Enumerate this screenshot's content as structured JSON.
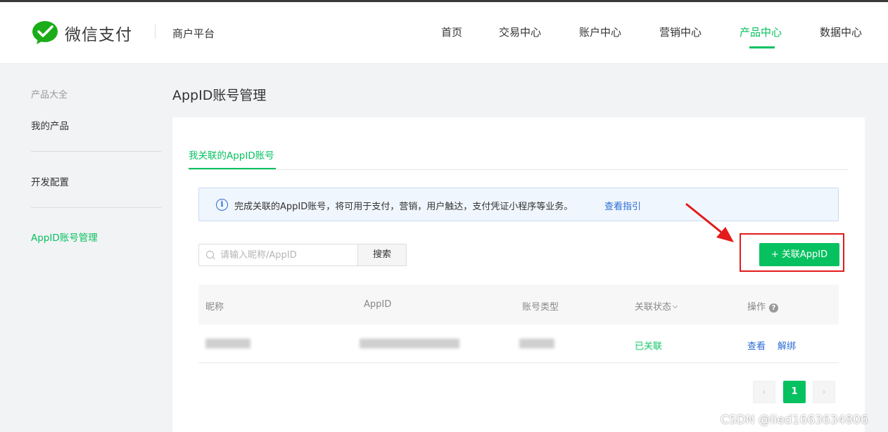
{
  "header": {
    "brand_name": "微信支付",
    "subtitle": "商户平台",
    "nav": [
      "首页",
      "交易中心",
      "账户中心",
      "营销中心",
      "产品中心",
      "数据中心"
    ],
    "active_nav": "产品中心"
  },
  "sidebar": {
    "group_label": "产品大全",
    "items": [
      "我的产品",
      "开发配置",
      "AppID账号管理"
    ],
    "active_item": "AppID账号管理"
  },
  "main": {
    "title": "AppID账号管理",
    "tab": "我关联的AppID账号",
    "notice_text": "完成关联的AppID账号，将可用于支付，营销，用户触达，支付凭证小程序等业务。",
    "notice_link": "查看指引",
    "search_placeholder": "请输入昵称/AppID",
    "search_button": "搜索",
    "add_button": "+ 关联AppID",
    "table": {
      "headers": [
        "昵称",
        "AppID",
        "账号类型",
        "关联状态",
        "操作"
      ],
      "rows": [
        {
          "status": "已关联",
          "actions": [
            "查看",
            "解绑"
          ]
        }
      ]
    },
    "pagination": {
      "current": "1",
      "prev": "‹",
      "next": "›"
    }
  },
  "watermark": "CSDN @lied1663634806",
  "colors": {
    "accent": "#07c160",
    "link": "#2b6cd4",
    "highlight": "#e31b1b"
  }
}
